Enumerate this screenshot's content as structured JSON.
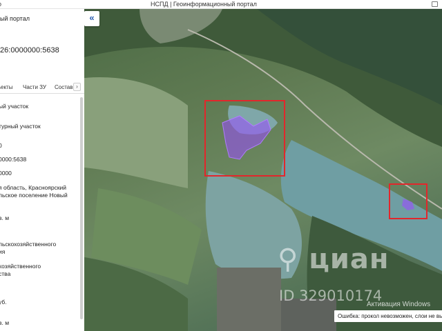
{
  "window": {
    "left_title": "о",
    "center_title": "НСПД | Геоинформационный портал"
  },
  "panel": {
    "portal_title": "ый портал",
    "cadastral_number": ":26:0000000:5638",
    "tabs": [
      "ъекты",
      "Части ЗУ",
      "Состав"
    ],
    "tab_next_label": "›",
    "fields": [
      "ый участок",
      "турный участок",
      "0",
      "0000:5638",
      "0000",
      "я область, Красноярский",
      "льское поселение Новый",
      "в. м",
      "льскохозяйственного",
      "ия",
      "хозяйственного",
      "ства",
      "уб.",
      "в. м"
    ]
  },
  "map": {
    "collapse_label": "«",
    "watermark_logo": "⚲ циан",
    "watermark_id": "ID 329010174",
    "windows_activation": "Активация Windows",
    "error_message": "Ошибка: прокол невозможен, слои не выбраны",
    "colors": {
      "selection_box": "#e3262b",
      "parcel_highlight": "#9b4dff",
      "water": "#6f9ea3"
    }
  }
}
